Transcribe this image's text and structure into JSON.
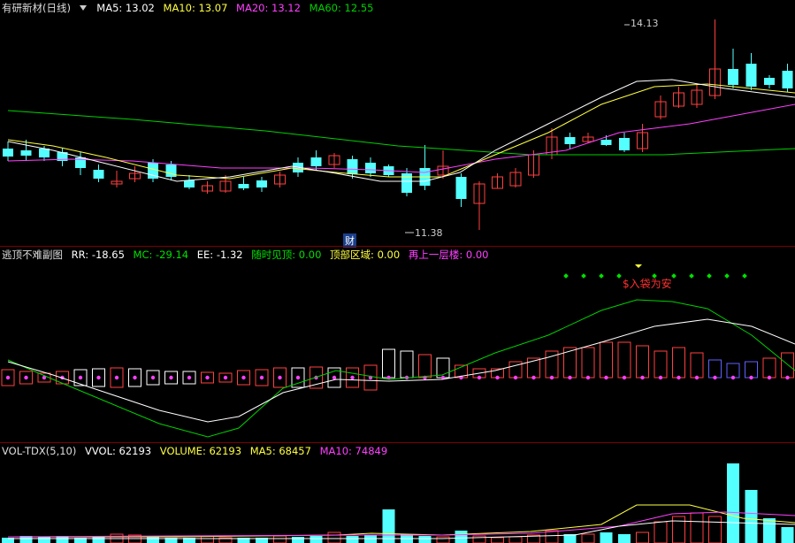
{
  "colors": {
    "up": "#ff4040",
    "down": "#54ffff",
    "ma5": "#ffffff",
    "ma10": "#ffff40",
    "ma20": "#ff40ff",
    "ma60": "#00d000",
    "sep": "#7a0000"
  },
  "main": {
    "title": "有研新材(日线)",
    "indicators": [
      {
        "label": "MA5: 13.02",
        "color": "#ffffff"
      },
      {
        "label": "MA10: 13.07",
        "color": "#ffff40"
      },
      {
        "label": "MA20: 13.12",
        "color": "#ff40ff"
      },
      {
        "label": "MA60: 12.55",
        "color": "#00d000"
      }
    ],
    "high_label": "14.13",
    "low_label": "11.38",
    "event_badge": "财"
  },
  "sub": {
    "title": "逃顶不难副图",
    "indicators": [
      {
        "label": "RR: -18.65",
        "color": "#ffffff"
      },
      {
        "label": "MC: -29.14",
        "color": "#00e000"
      },
      {
        "label": "EE: -1.32",
        "color": "#ffffff"
      },
      {
        "label": "随时见顶: 0.00",
        "color": "#00e000"
      },
      {
        "label": "顶部区域: 0.00",
        "color": "#ffff40"
      },
      {
        "label": "再上一层楼: 0.00",
        "color": "#ff40ff"
      }
    ],
    "signal_text": "$入袋为安"
  },
  "vol": {
    "title": "VOL-TDX(5,10)",
    "indicators": [
      {
        "label": "VVOL: 62193",
        "color": "#ffffff"
      },
      {
        "label": "VOLUME: 62193",
        "color": "#ffff40"
      },
      {
        "label": "MA5: 68457",
        "color": "#ffff40"
      },
      {
        "label": "MA10: 74849",
        "color": "#ff40ff"
      }
    ]
  }
}
